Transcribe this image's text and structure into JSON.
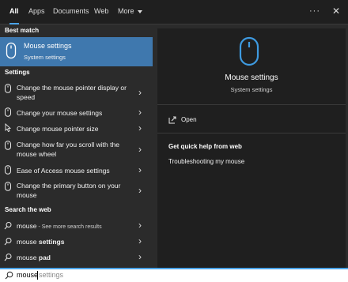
{
  "tabs": {
    "all": "All",
    "apps": "Apps",
    "documents": "Documents",
    "web": "Web",
    "more": "More"
  },
  "topbar": {
    "more_options_icon": "ellipsis-icon",
    "close_icon": "close-icon",
    "more_options": "···",
    "close": "✕"
  },
  "left": {
    "best_match_header": "Best match",
    "best_match": {
      "title": "Mouse settings",
      "subtitle": "System settings",
      "icon": "mouse-icon"
    },
    "settings_header": "Settings",
    "settings": [
      {
        "label": "Change the mouse pointer display or speed",
        "icon": "mouse-icon"
      },
      {
        "label": "Change your mouse settings",
        "icon": "mouse-icon"
      },
      {
        "label": "Change mouse pointer size",
        "icon": "pointer-icon"
      },
      {
        "label": "Change how far you scroll with the mouse wheel",
        "icon": "mouse-icon"
      },
      {
        "label": "Ease of Access mouse settings",
        "icon": "mouse-icon"
      },
      {
        "label": "Change the primary button on your mouse",
        "icon": "mouse-icon"
      }
    ],
    "web_header": "Search the web",
    "web": [
      {
        "prefix": "mouse",
        "bold": "",
        "suffix": " - See more search results",
        "icon": "search-icon"
      },
      {
        "prefix": "mouse ",
        "bold": "settings",
        "suffix": "",
        "icon": "search-icon"
      },
      {
        "prefix": "mouse ",
        "bold": "pad",
        "suffix": "",
        "icon": "search-icon"
      }
    ],
    "chevron": "›"
  },
  "right": {
    "title": "Mouse settings",
    "subtitle": "System settings",
    "open_label": "Open",
    "help_header": "Get quick help from web",
    "help_link": "Troubleshooting my mouse"
  },
  "search": {
    "typed": "mouse",
    "suggestion": "settings"
  },
  "colors": {
    "accent": "#4aa3e8",
    "selected_bg": "#3f78ae"
  }
}
